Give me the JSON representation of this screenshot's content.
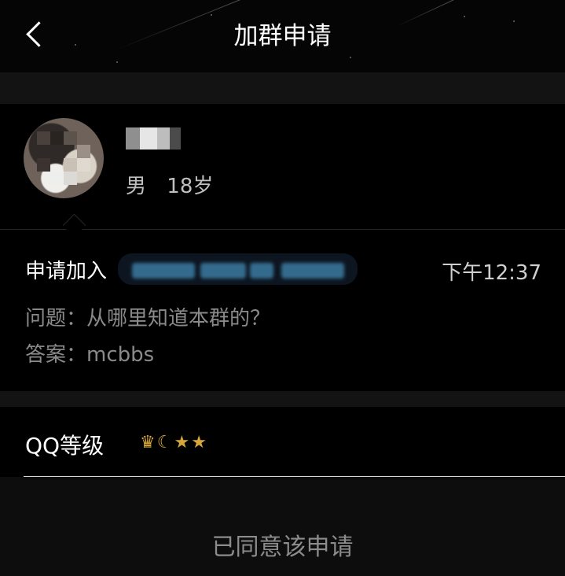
{
  "header": {
    "title": "加群申请",
    "back_icon": "chevron-left-icon"
  },
  "applicant": {
    "gender": "男",
    "age": "18岁"
  },
  "request": {
    "prefix": "申请加入",
    "time": "下午12:37",
    "question": "问题：从哪里知道本群的？",
    "answer": "答案：mcbbs"
  },
  "qq_level": {
    "label": "QQ等级",
    "icons": [
      "crown-icon",
      "moon-icon",
      "star-icon",
      "star-icon"
    ],
    "icon_color": "#d6a63a"
  },
  "footer": {
    "status": "已同意该申请"
  },
  "colors": {
    "background": "#000000",
    "muted_text": "#8a8a8a",
    "bar": "#131313"
  }
}
